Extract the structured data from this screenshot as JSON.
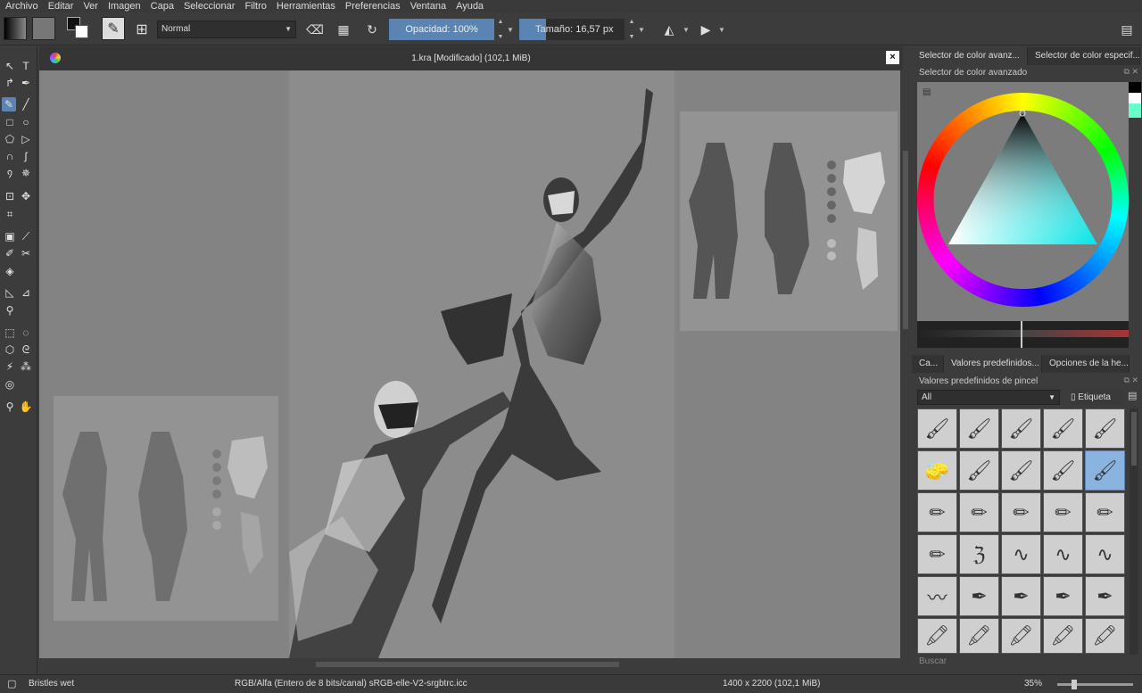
{
  "menu": [
    "Archivo",
    "Editar",
    "Ver",
    "Imagen",
    "Capa",
    "Seleccionar",
    "Filtro",
    "Herramientas",
    "Preferencias",
    "Ventana",
    "Ayuda"
  ],
  "toolbar": {
    "blend_mode": "Normal",
    "opacity_label": "Opacidad:  100%",
    "size_label": "Tamaño:  16,57 px"
  },
  "document": {
    "title": "1.kra [Modificado]  (102,1 MiB)"
  },
  "dock": {
    "top_tabs": [
      "Selector de color avanz...",
      "Selector de color especif..."
    ],
    "color_panel_title": "Selector de color avanzado",
    "mid_tabs": [
      "Ca...",
      "Valores predefinidos...",
      "Opciones de la he..."
    ],
    "presets_title": "Valores predefinidos de pincel",
    "filter_value": "All",
    "tag_label": "Etiqueta",
    "search_placeholder": "Buscar"
  },
  "status": {
    "brush": "Bristles wet",
    "color_space": "RGB/Alfa (Entero de 8 bits/canal)  sRGB-elle-V2-srgbtrc.icc",
    "dimensions": "1400 x 2200 (102,1 MiB)",
    "zoom": "35%"
  }
}
